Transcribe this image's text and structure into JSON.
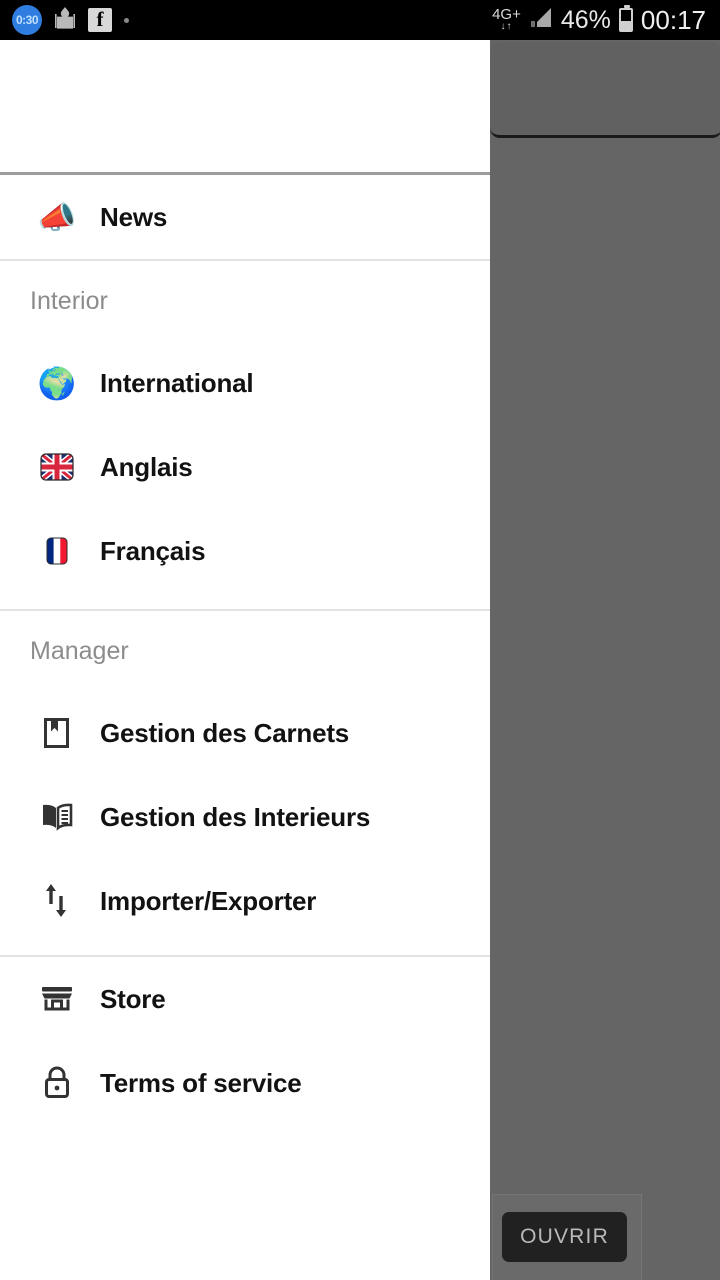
{
  "status_bar": {
    "timer_badge": "0:30",
    "mosque_icon": "mosque-icon",
    "facebook_icon": "f",
    "more_notifications_icon": "more-dot-icon",
    "network_type": "4G+",
    "network_arrows": "↓↑",
    "signal_icon": "signal-bars-icon",
    "battery_percent": "46%",
    "battery_icon": "battery-icon",
    "clock": "00:17"
  },
  "drawer": {
    "sections": [
      {
        "header": null,
        "items": [
          {
            "label": "News",
            "icon": "megaphone-icon",
            "glyph": "📣"
          }
        ]
      },
      {
        "header": "Interior",
        "items": [
          {
            "label": "International",
            "icon": "globe-icon",
            "glyph": "🌍"
          },
          {
            "label": "Anglais",
            "icon": "uk-flag-icon",
            "glyph": "🇬🇧"
          },
          {
            "label": "Français",
            "icon": "france-flag-icon",
            "glyph": "🇫🇷"
          }
        ]
      },
      {
        "header": "Manager",
        "items": [
          {
            "label": "Gestion des Carnets",
            "icon": "bookmark-book-icon",
            "glyph": ""
          },
          {
            "label": "Gestion des Interieurs",
            "icon": "open-book-icon",
            "glyph": ""
          },
          {
            "label": "Importer/Exporter",
            "icon": "import-export-arrows-icon",
            "glyph": ""
          }
        ]
      },
      {
        "header": null,
        "items": [
          {
            "label": "Store",
            "icon": "storefront-icon",
            "glyph": ""
          },
          {
            "label": "Terms of service",
            "icon": "lock-icon",
            "glyph": ""
          }
        ]
      }
    ]
  },
  "background": {
    "open_button_label": "OUVRIR"
  },
  "colors": {
    "status_bar_bg": "#000000",
    "drawer_bg": "#ffffff",
    "scrim": "#656565",
    "label_text": "#121212",
    "section_text": "#8c8c8c",
    "divider_strong": "#9d9d9d",
    "divider_light": "#e2e2e2",
    "open_button_bg": "#212121",
    "open_button_text": "#b9b9b9",
    "timer_badge_bg": "#2f7de1"
  }
}
